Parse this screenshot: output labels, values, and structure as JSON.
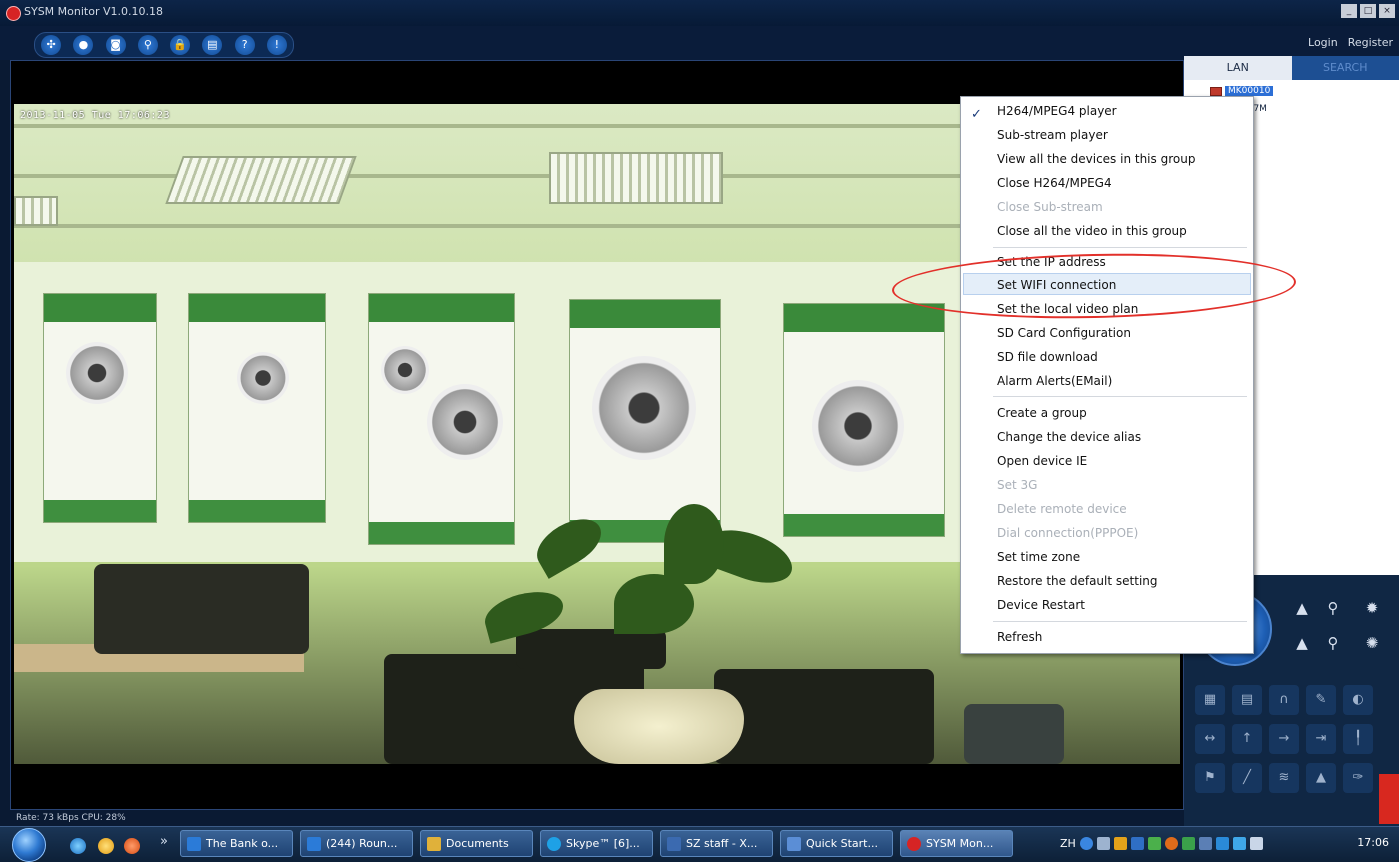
{
  "window": {
    "title": "SYSM Monitor  V1.0.10.18"
  },
  "toolbar": {
    "buttons": [
      "✣",
      "●",
      "◙",
      "⚲",
      "🔒",
      "▤",
      "?",
      "!"
    ],
    "login": "Login",
    "register": "Register"
  },
  "video": {
    "timestamp": "2013-11-05 Tue 17:06:23",
    "status_line": "Rate: 73 kBps  CPU: 28%"
  },
  "right_panel": {
    "tabs": [
      "LAN",
      "SEARCH"
    ],
    "devices": [
      "MK00010",
      "007M"
    ]
  },
  "context_menu": {
    "checked_item": "H264/MPEG4 player",
    "items": [
      {
        "label": "H264/MPEG4 player",
        "disabled": false
      },
      {
        "label": "Sub-stream player",
        "disabled": false
      },
      {
        "label": "View all the devices in this group",
        "disabled": false
      },
      {
        "label": "Close H264/MPEG4",
        "disabled": false
      },
      {
        "label": "Close Sub-stream",
        "disabled": true
      },
      {
        "label": "Close all the video in this group",
        "disabled": false
      },
      {
        "label": "Set the IP address",
        "disabled": false
      },
      {
        "label": "Set WIFI connection",
        "disabled": false
      },
      {
        "label": "Set the local video plan",
        "disabled": false
      },
      {
        "label": "SD Card Configuration",
        "disabled": false
      },
      {
        "label": "SD file download",
        "disabled": false
      },
      {
        "label": "Alarm Alerts(EMail)",
        "disabled": false
      },
      {
        "label": "Create a group",
        "disabled": false
      },
      {
        "label": "Change the device alias",
        "disabled": false
      },
      {
        "label": "Open device IE",
        "disabled": false
      },
      {
        "label": "Set 3G",
        "disabled": true
      },
      {
        "label": "Delete remote device",
        "disabled": true
      },
      {
        "label": "Dial connection(PPPOE)",
        "disabled": true
      },
      {
        "label": "Set time zone",
        "disabled": false
      },
      {
        "label": "Restore the default setting",
        "disabled": false
      },
      {
        "label": "Device Restart",
        "disabled": false
      },
      {
        "label": "Refresh",
        "disabled": false
      }
    ]
  },
  "taskbar": {
    "chevron": "»",
    "tasks": [
      {
        "label": "The Bank o...",
        "color": "#2b7bd8"
      },
      {
        "label": "(244) Roun...",
        "color": "#2b7bd8"
      },
      {
        "label": "Documents",
        "color": "#e0b13a"
      },
      {
        "label": "Skype™ [6]...",
        "color": "#1ea1e6"
      },
      {
        "label": "SZ staff - X...",
        "color": "#3b6ab0"
      },
      {
        "label": "Quick Start...",
        "color": "#5b8ed6"
      },
      {
        "label": "SYSM Mon...",
        "color": "#d62424"
      }
    ],
    "language": "ZH",
    "clock": "17:06"
  },
  "colors": {
    "accent": "#2c6fd6",
    "highlight_ellipse": "#e2302a",
    "title_bg": "#0d2548"
  }
}
